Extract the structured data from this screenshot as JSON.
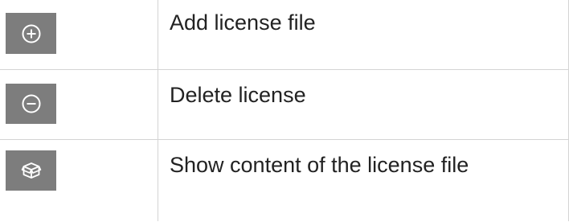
{
  "rows": [
    {
      "icon": "add-circle-icon",
      "label": "Add license file"
    },
    {
      "icon": "remove-circle-icon",
      "label": "Delete license"
    },
    {
      "icon": "open-box-icon",
      "label": "Show content of the license file"
    }
  ],
  "colors": {
    "icon_background": "#7d7d7d",
    "icon_foreground": "#ffffff",
    "grid_lines": "#d4d4d4",
    "text": "#222222"
  }
}
